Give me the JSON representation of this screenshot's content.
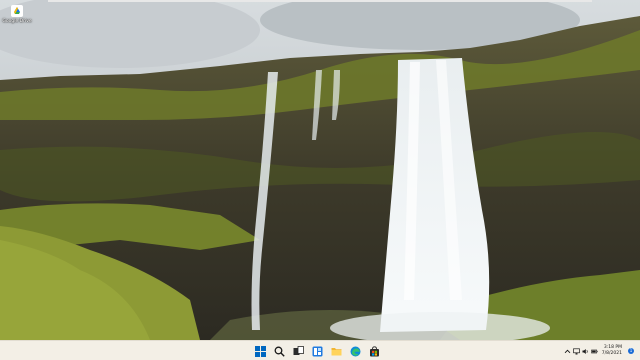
{
  "desktop": {
    "icons": [
      {
        "label": "Google Drive",
        "icon": "google-drive-icon"
      }
    ]
  },
  "taskbar": {
    "pinned": [
      {
        "name": "start-button",
        "icon": "windows-logo-icon"
      },
      {
        "name": "search-button",
        "icon": "search-icon"
      },
      {
        "name": "task-view-button",
        "icon": "task-view-icon"
      },
      {
        "name": "widgets-button",
        "icon": "widgets-icon"
      },
      {
        "name": "file-explorer-button",
        "icon": "folder-icon"
      },
      {
        "name": "edge-button",
        "icon": "edge-icon"
      },
      {
        "name": "store-button",
        "icon": "store-bag-icon"
      }
    ],
    "tray": {
      "icons": [
        "chevron-up-icon",
        "network-icon",
        "speaker-icon",
        "battery-icon"
      ],
      "time": "3:18 PM",
      "date": "7/8/2021",
      "notification_count": "1"
    },
    "accent_color": "#0067c0",
    "background_color": "#f3efe6"
  }
}
